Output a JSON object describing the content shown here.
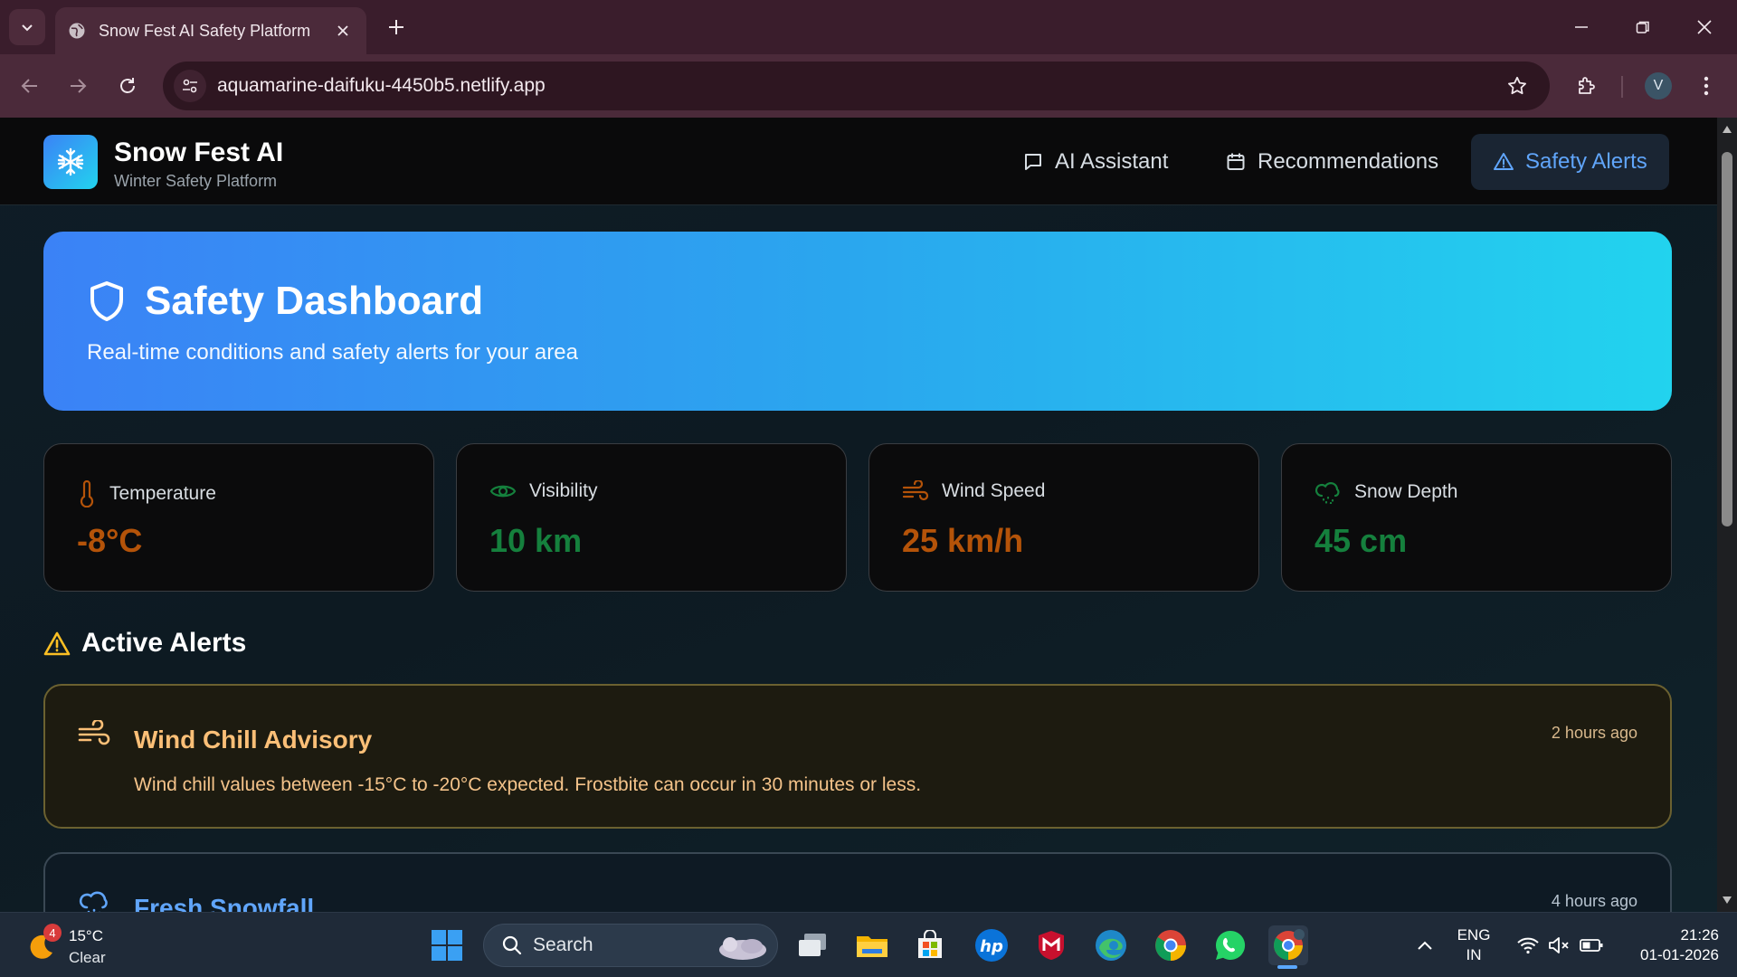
{
  "browser": {
    "tab_title": "Snow Fest AI Safety Platform",
    "url": "aquamarine-daifuku-4450b5.netlify.app",
    "profile_initial": "V"
  },
  "app": {
    "brand_name": "Snow Fest AI",
    "brand_subtitle": "Winter Safety Platform",
    "nav": [
      {
        "label": "AI Assistant",
        "icon": "chat-bubble-icon",
        "active": false
      },
      {
        "label": "Recommendations",
        "icon": "calendar-icon",
        "active": false
      },
      {
        "label": "Safety Alerts",
        "icon": "warning-triangle-icon",
        "active": true
      }
    ]
  },
  "hero": {
    "title": "Safety Dashboard",
    "subtitle": "Real-time conditions and safety alerts for your area"
  },
  "stats": [
    {
      "label": "Temperature",
      "value": "-8°C",
      "icon": "thermometer-icon",
      "color": "#b45309"
    },
    {
      "label": "Visibility",
      "value": "10 km",
      "icon": "eye-icon",
      "color": "#15803d"
    },
    {
      "label": "Wind Speed",
      "value": "25 km/h",
      "icon": "wind-icon",
      "color": "#b45309"
    },
    {
      "label": "Snow Depth",
      "value": "45 cm",
      "icon": "cloud-snow-icon",
      "color": "#15803d"
    }
  ],
  "alerts_section_title": "Active Alerts",
  "alerts": [
    {
      "title": "Wind Chill Advisory",
      "description": "Wind chill values between -15°C to -20°C expected. Frostbite can occur in 30 minutes or less.",
      "time": "2 hours ago",
      "icon": "wind-icon",
      "color": "#fbbf77"
    },
    {
      "title": "Fresh Snowfall",
      "description": "",
      "time": "4 hours ago",
      "icon": "cloud-snow-icon",
      "color": "#60a5fa"
    }
  ],
  "taskbar": {
    "weather_temp": "15°C",
    "weather_condition": "Clear",
    "weather_badge": "4",
    "search_placeholder": "Search",
    "lang_line1": "ENG",
    "lang_line2": "IN",
    "time": "21:26",
    "date": "01-01-2026"
  },
  "colors": {
    "accent_blue": "#3b82f6",
    "accent_cyan": "#22d3ee",
    "warning_amber": "#fbbf24",
    "browser_frame": "#3a1d2c"
  }
}
